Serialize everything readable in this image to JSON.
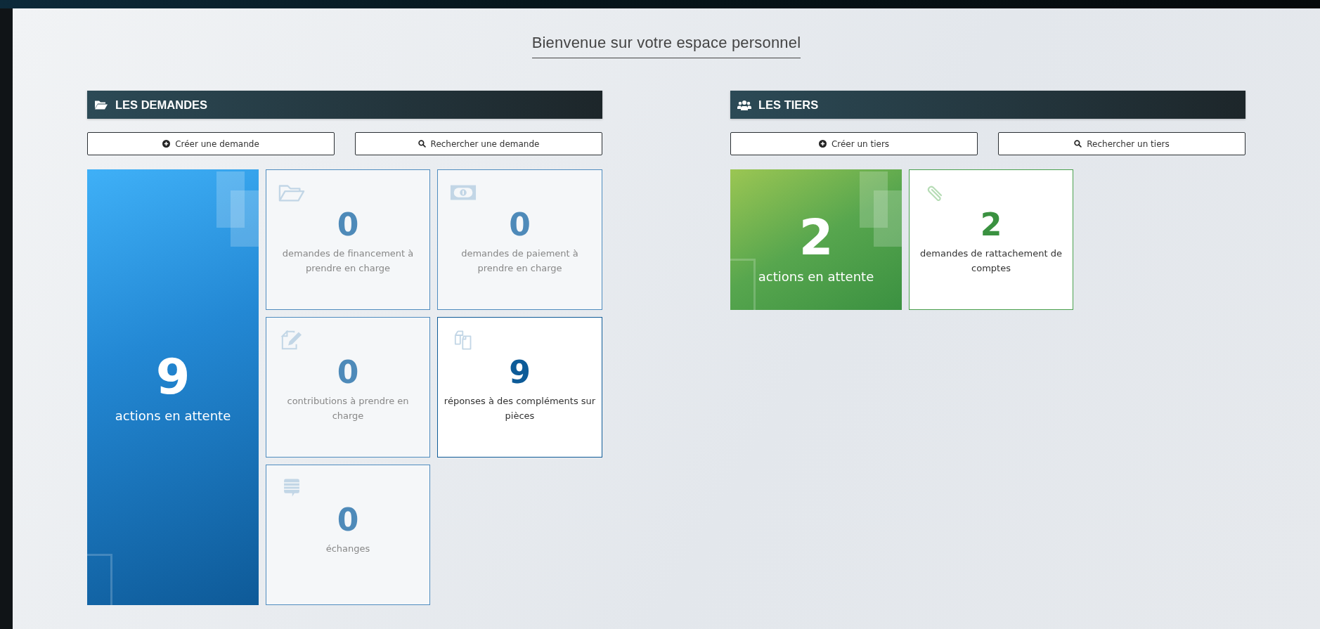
{
  "welcome": "Bienvenue sur votre espace personnel",
  "sections": [
    {
      "title": "LES DEMANDES",
      "kind": "requests",
      "buttons": [
        {
          "label": "Créer une demande",
          "kind": "create"
        },
        {
          "label": "Rechercher une demande",
          "kind": "search"
        }
      ],
      "summary": {
        "count": "9",
        "label": "actions en attente"
      },
      "tiles": [
        {
          "kind": "folder",
          "count": "0",
          "label": "demandes de financement à prendre en charge",
          "active": false
        },
        {
          "kind": "banknote",
          "count": "0",
          "label": "demandes de paiement à prendre en charge",
          "active": false
        },
        {
          "kind": "edit",
          "count": "0",
          "label": "contributions à prendre en charge",
          "active": false
        },
        {
          "kind": "copy",
          "count": "9",
          "label": "réponses à des compléments sur pièces",
          "active": true
        },
        {
          "kind": "chat",
          "count": "0",
          "label": "échanges",
          "active": false
        }
      ]
    },
    {
      "title": "LES TIERS",
      "kind": "parties",
      "buttons": [
        {
          "label": "Créer un tiers",
          "kind": "create"
        },
        {
          "label": "Rechercher un tiers",
          "kind": "search"
        }
      ],
      "summary": {
        "count": "2",
        "label": "actions en attente"
      },
      "tiles": [
        {
          "kind": "paperclip",
          "count": "2",
          "label": "demandes de rattachement de comptes",
          "active": true
        }
      ]
    }
  ]
}
